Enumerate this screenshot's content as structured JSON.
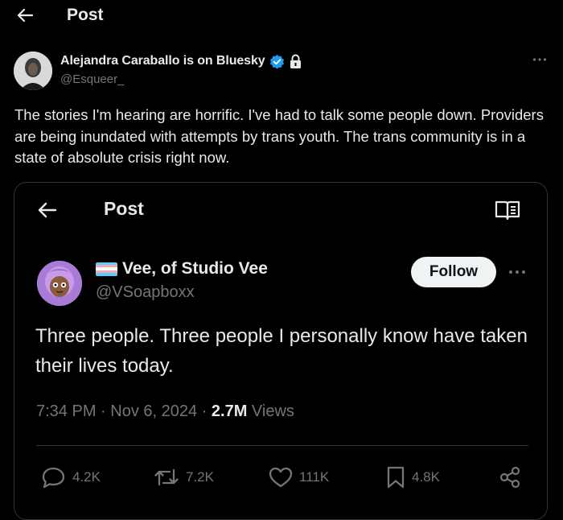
{
  "header": {
    "title": "Post",
    "back_icon": "arrow-left-icon"
  },
  "outer_post": {
    "author_name": "Alejandra Caraballo is on Bluesky",
    "verified_icon": "verified-badge-icon",
    "protected_icon": "lock-icon",
    "handle": "@Esqueer_",
    "text": "The stories I'm hearing are horrific. I've had to talk some people down. Providers are being inundated with attempts by trans youth. The trans community is in a state of absolute crisis right now."
  },
  "quoted_post": {
    "header_title": "Post",
    "author_name": "Vee, of Studio Vee",
    "flag_colors": [
      "#5BCEFA",
      "#F5A9B8",
      "#FFFFFF",
      "#F5A9B8",
      "#5BCEFA"
    ],
    "handle": "@VSoapboxx",
    "follow_label": "Follow",
    "text": "Three people. Three people I personally know have taken their lives today.",
    "meta_time": "7:34 PM · Nov 6, 2024 · ",
    "views_count": "2.7M",
    "views_label": " Views",
    "actions": {
      "replies": "4.2K",
      "reposts": "7.2K",
      "likes": "111K",
      "bookmarks": "4.8K"
    }
  },
  "colors": {
    "background": "#000000",
    "text_primary": "#e7e9ea",
    "text_secondary": "#71767b",
    "verified_blue": "#1d9bf0",
    "border": "#2f3336"
  }
}
